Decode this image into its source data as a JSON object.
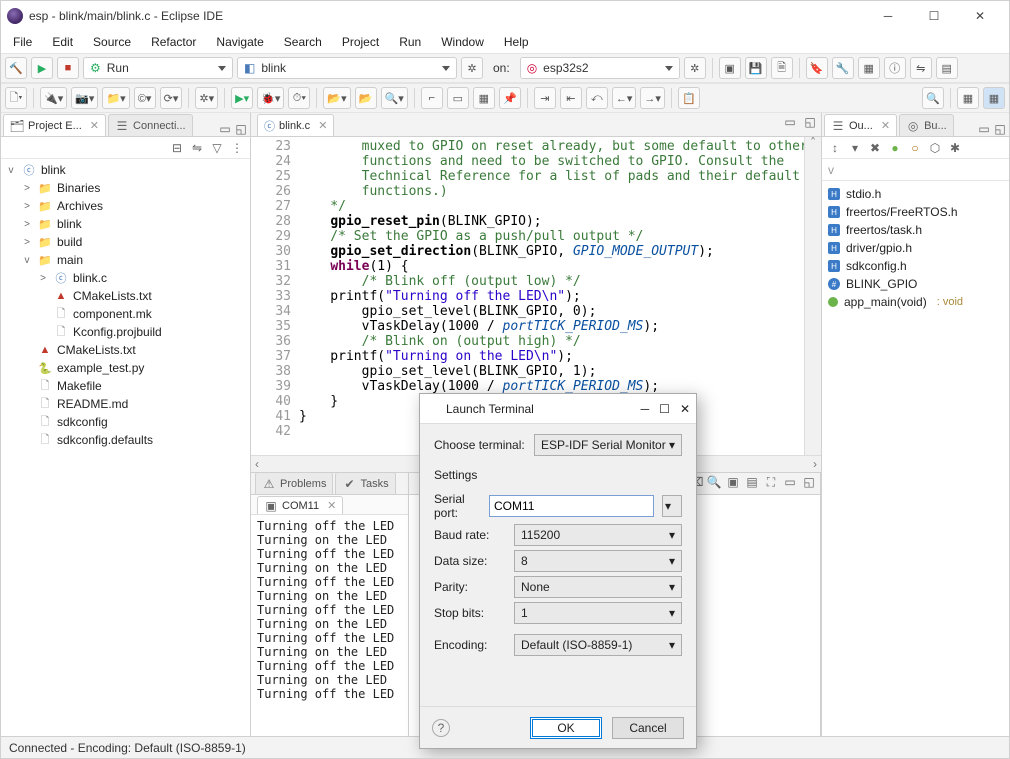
{
  "window": {
    "title": "esp - blink/main/blink.c - Eclipse IDE"
  },
  "menubar": [
    "File",
    "Edit",
    "Source",
    "Refactor",
    "Navigate",
    "Search",
    "Project",
    "Run",
    "Window",
    "Help"
  ],
  "tool1": {
    "run_combo": "Run",
    "launch_combo": "blink",
    "on_label": "on:",
    "target_combo": "esp32s2"
  },
  "left": {
    "tabs": {
      "project": "Project E...",
      "connect": "Connecti..."
    },
    "tree": [
      {
        "lvl": 0,
        "tw": "v",
        "icon": "cfile",
        "label": "blink"
      },
      {
        "lvl": 1,
        "tw": ">",
        "icon": "fold",
        "label": "Binaries"
      },
      {
        "lvl": 1,
        "tw": ">",
        "icon": "fold",
        "label": "Archives"
      },
      {
        "lvl": 1,
        "tw": ">",
        "icon": "fold",
        "label": "blink"
      },
      {
        "lvl": 1,
        "tw": ">",
        "icon": "fold",
        "label": "build"
      },
      {
        "lvl": 1,
        "tw": "v",
        "icon": "fold",
        "label": "main"
      },
      {
        "lvl": 2,
        "tw": ">",
        "icon": "cfile",
        "label": "blink.c"
      },
      {
        "lvl": 2,
        "tw": "",
        "icon": "cmake",
        "label": "CMakeLists.txt"
      },
      {
        "lvl": 2,
        "tw": "",
        "icon": "txtfile",
        "label": "component.mk"
      },
      {
        "lvl": 2,
        "tw": "",
        "icon": "txtfile",
        "label": "Kconfig.projbuild"
      },
      {
        "lvl": 1,
        "tw": "",
        "icon": "cmake",
        "label": "CMakeLists.txt"
      },
      {
        "lvl": 1,
        "tw": "",
        "icon": "pyfile",
        "label": "example_test.py"
      },
      {
        "lvl": 1,
        "tw": "",
        "icon": "txtfile",
        "label": "Makefile"
      },
      {
        "lvl": 1,
        "tw": "",
        "icon": "txtfile",
        "label": "README.md"
      },
      {
        "lvl": 1,
        "tw": "",
        "icon": "txtfile",
        "label": "sdkconfig"
      },
      {
        "lvl": 1,
        "tw": "",
        "icon": "txtfile",
        "label": "sdkconfig.defaults"
      }
    ]
  },
  "editor": {
    "tab_label": "blink.c",
    "lines": [
      {
        "n": 23,
        "indent": 8,
        "cls": "cmt",
        "text": "muxed to GPIO on reset already, but some default to other"
      },
      {
        "n": 24,
        "indent": 8,
        "cls": "cmt",
        "text": "functions and need to be switched to GPIO. Consult the"
      },
      {
        "n": 25,
        "indent": 8,
        "cls": "cmt",
        "text": "Technical Reference for a list of pads and their default"
      },
      {
        "n": 26,
        "indent": 8,
        "cls": "cmt",
        "text": "functions.)"
      },
      {
        "n": 27,
        "indent": 4,
        "cls": "cmt",
        "text": "*/"
      },
      {
        "n": 28,
        "indent": 4,
        "cls": "",
        "html": "<span class='fn'>gpio_reset_pin</span>(BLINK_GPIO);"
      },
      {
        "n": 29,
        "indent": 4,
        "cls": "cmt",
        "text": "/* Set the GPIO as a push/pull output */"
      },
      {
        "n": 30,
        "indent": 4,
        "cls": "",
        "html": "<span class='fn'>gpio_set_direction</span>(BLINK_GPIO, <span class='mac'>GPIO_MODE_OUTPUT</span>);"
      },
      {
        "n": 31,
        "indent": 4,
        "cls": "",
        "html": "<span class='kw'>while</span>(1) {"
      },
      {
        "n": 32,
        "indent": 8,
        "cls": "cmt",
        "text": "/* Blink off (output low) */"
      },
      {
        "n": 33,
        "indent": 4,
        "cls": "",
        "html": "printf(<span class='str'>\"Turning off the LED\\n\"</span>);"
      },
      {
        "n": 34,
        "indent": 8,
        "cls": "",
        "html": "gpio_set_level(BLINK_GPIO, 0);"
      },
      {
        "n": 35,
        "indent": 8,
        "cls": "",
        "html": "vTaskDelay(1000 / <span class='mac'>portTICK_PERIOD_MS</span>);"
      },
      {
        "n": 36,
        "indent": 8,
        "cls": "cmt",
        "text": "/* Blink on (output high) */"
      },
      {
        "n": 37,
        "indent": 4,
        "cls": "",
        "html": "printf(<span class='str'>\"Turning on the LED\\n\"</span>);"
      },
      {
        "n": 38,
        "indent": 8,
        "cls": "",
        "html": "gpio_set_level(BLINK_GPIO, 1);"
      },
      {
        "n": 39,
        "indent": 8,
        "cls": "",
        "html": "vTaskDelay(1000 / <span class='mac'>portTICK_PERIOD_MS</span>);"
      },
      {
        "n": 40,
        "indent": 4,
        "cls": "",
        "html": "}"
      },
      {
        "n": 41,
        "indent": 0,
        "cls": "",
        "html": "}"
      },
      {
        "n": 42,
        "indent": 0,
        "cls": "",
        "html": ""
      }
    ]
  },
  "bottom": {
    "tabs": {
      "problems": "Problems",
      "tasks": "Tasks"
    },
    "subtab": "COM11",
    "terminal_lines": [
      "Turning off the LED",
      "Turning on the LED",
      "Turning off the LED",
      "Turning on the LED",
      "Turning off the LED",
      "Turning on the LED",
      "Turning off the LED",
      "Turning on the LED",
      "Turning off the LED",
      "Turning on the LED",
      "Turning off the LED",
      "Turning on the LED",
      "Turning off the LED"
    ]
  },
  "right": {
    "tabs": {
      "outline": "Ou...",
      "build": "Bu..."
    },
    "items": [
      {
        "kind": "h",
        "label": "stdio.h"
      },
      {
        "kind": "h",
        "label": "freertos/FreeRTOS.h"
      },
      {
        "kind": "h",
        "label": "freertos/task.h"
      },
      {
        "kind": "h",
        "label": "driver/gpio.h"
      },
      {
        "kind": "h",
        "label": "sdkconfig.h"
      },
      {
        "kind": "d",
        "label": "BLINK_GPIO"
      },
      {
        "kind": "f",
        "label": "app_main(void)",
        "extra": ": void"
      }
    ]
  },
  "dialog": {
    "title": "Launch Terminal",
    "choose_label": "Choose terminal:",
    "choose_value": "ESP-IDF Serial Monitor",
    "settings_label": "Settings",
    "rows": [
      {
        "label": "Serial port:",
        "value": "COM11",
        "type": "input"
      },
      {
        "label": "Baud rate:",
        "value": "115200",
        "type": "combo"
      },
      {
        "label": "Data size:",
        "value": "8",
        "type": "combo"
      },
      {
        "label": "Parity:",
        "value": "None",
        "type": "combo"
      },
      {
        "label": "Stop bits:",
        "value": "1",
        "type": "combo"
      },
      {
        "label": "Encoding:",
        "value": "Default (ISO-8859-1)",
        "type": "combo"
      }
    ],
    "ok": "OK",
    "cancel": "Cancel"
  },
  "status": "Connected - Encoding: Default (ISO-8859-1)"
}
